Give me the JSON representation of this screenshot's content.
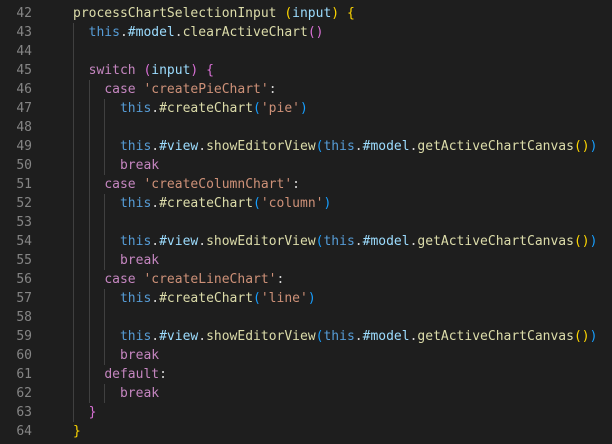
{
  "editor": {
    "lines": [
      {
        "num": "42",
        "tokens": [
          [
            "fn",
            "processChartSelectionInput"
          ],
          [
            "pl",
            " "
          ],
          [
            "b1",
            "("
          ],
          [
            "var",
            "input"
          ],
          [
            "b1",
            ")"
          ],
          [
            "pl",
            " "
          ],
          [
            "b1",
            "{"
          ]
        ]
      },
      {
        "num": "43",
        "tokens": [
          [
            "pl",
            "  "
          ],
          [
            "kw",
            "this"
          ],
          [
            "pl",
            "."
          ],
          [
            "var",
            "#model"
          ],
          [
            "pl",
            "."
          ],
          [
            "fn",
            "clearActiveChart"
          ],
          [
            "b2",
            "()"
          ]
        ]
      },
      {
        "num": "44",
        "tokens": []
      },
      {
        "num": "45",
        "tokens": [
          [
            "pl",
            "  "
          ],
          [
            "ctl",
            "switch"
          ],
          [
            "pl",
            " "
          ],
          [
            "b2",
            "("
          ],
          [
            "var",
            "input"
          ],
          [
            "b2",
            ")"
          ],
          [
            "pl",
            " "
          ],
          [
            "b2",
            "{"
          ]
        ]
      },
      {
        "num": "46",
        "tokens": [
          [
            "pl",
            "    "
          ],
          [
            "ctl",
            "case"
          ],
          [
            "pl",
            " "
          ],
          [
            "str",
            "'createPieChart'"
          ],
          [
            "pl",
            ":"
          ]
        ]
      },
      {
        "num": "47",
        "tokens": [
          [
            "pl",
            "      "
          ],
          [
            "kw",
            "this"
          ],
          [
            "pl",
            "."
          ],
          [
            "fn",
            "#createChart"
          ],
          [
            "b3",
            "("
          ],
          [
            "str",
            "'pie'"
          ],
          [
            "b3",
            ")"
          ]
        ]
      },
      {
        "num": "48",
        "tokens": []
      },
      {
        "num": "49",
        "tokens": [
          [
            "pl",
            "      "
          ],
          [
            "kw",
            "this"
          ],
          [
            "pl",
            "."
          ],
          [
            "var",
            "#view"
          ],
          [
            "pl",
            "."
          ],
          [
            "fn",
            "showEditorView"
          ],
          [
            "b3",
            "("
          ],
          [
            "kw",
            "this"
          ],
          [
            "pl",
            "."
          ],
          [
            "var",
            "#model"
          ],
          [
            "pl",
            "."
          ],
          [
            "fn",
            "getActiveChartCanvas"
          ],
          [
            "b1",
            "()"
          ],
          [
            "b3",
            ")"
          ]
        ]
      },
      {
        "num": "50",
        "tokens": [
          [
            "pl",
            "      "
          ],
          [
            "ctl",
            "break"
          ]
        ]
      },
      {
        "num": "51",
        "tokens": [
          [
            "pl",
            "    "
          ],
          [
            "ctl",
            "case"
          ],
          [
            "pl",
            " "
          ],
          [
            "str",
            "'createColumnChart'"
          ],
          [
            "pl",
            ":"
          ]
        ]
      },
      {
        "num": "52",
        "tokens": [
          [
            "pl",
            "      "
          ],
          [
            "kw",
            "this"
          ],
          [
            "pl",
            "."
          ],
          [
            "fn",
            "#createChart"
          ],
          [
            "b3",
            "("
          ],
          [
            "str",
            "'column'"
          ],
          [
            "b3",
            ")"
          ]
        ]
      },
      {
        "num": "53",
        "tokens": []
      },
      {
        "num": "54",
        "tokens": [
          [
            "pl",
            "      "
          ],
          [
            "kw",
            "this"
          ],
          [
            "pl",
            "."
          ],
          [
            "var",
            "#view"
          ],
          [
            "pl",
            "."
          ],
          [
            "fn",
            "showEditorView"
          ],
          [
            "b3",
            "("
          ],
          [
            "kw",
            "this"
          ],
          [
            "pl",
            "."
          ],
          [
            "var",
            "#model"
          ],
          [
            "pl",
            "."
          ],
          [
            "fn",
            "getActiveChartCanvas"
          ],
          [
            "b1",
            "()"
          ],
          [
            "b3",
            ")"
          ]
        ]
      },
      {
        "num": "55",
        "tokens": [
          [
            "pl",
            "      "
          ],
          [
            "ctl",
            "break"
          ]
        ]
      },
      {
        "num": "56",
        "tokens": [
          [
            "pl",
            "    "
          ],
          [
            "ctl",
            "case"
          ],
          [
            "pl",
            " "
          ],
          [
            "str",
            "'createLineChart'"
          ],
          [
            "pl",
            ":"
          ]
        ]
      },
      {
        "num": "57",
        "tokens": [
          [
            "pl",
            "      "
          ],
          [
            "kw",
            "this"
          ],
          [
            "pl",
            "."
          ],
          [
            "fn",
            "#createChart"
          ],
          [
            "b3",
            "("
          ],
          [
            "str",
            "'line'"
          ],
          [
            "b3",
            ")"
          ]
        ]
      },
      {
        "num": "58",
        "tokens": []
      },
      {
        "num": "59",
        "tokens": [
          [
            "pl",
            "      "
          ],
          [
            "kw",
            "this"
          ],
          [
            "pl",
            "."
          ],
          [
            "var",
            "#view"
          ],
          [
            "pl",
            "."
          ],
          [
            "fn",
            "showEditorView"
          ],
          [
            "b3",
            "("
          ],
          [
            "kw",
            "this"
          ],
          [
            "pl",
            "."
          ],
          [
            "var",
            "#model"
          ],
          [
            "pl",
            "."
          ],
          [
            "fn",
            "getActiveChartCanvas"
          ],
          [
            "b1",
            "()"
          ],
          [
            "b3",
            ")"
          ]
        ]
      },
      {
        "num": "60",
        "tokens": [
          [
            "pl",
            "      "
          ],
          [
            "ctl",
            "break"
          ]
        ]
      },
      {
        "num": "61",
        "tokens": [
          [
            "pl",
            "    "
          ],
          [
            "ctl",
            "default"
          ],
          [
            "pl",
            ":"
          ]
        ]
      },
      {
        "num": "62",
        "tokens": [
          [
            "pl",
            "      "
          ],
          [
            "ctl",
            "break"
          ]
        ]
      },
      {
        "num": "63",
        "tokens": [
          [
            "pl",
            "  "
          ],
          [
            "b2",
            "}"
          ]
        ]
      },
      {
        "num": "64",
        "tokens": [
          [
            "b1",
            "}"
          ]
        ]
      }
    ]
  },
  "colors": {
    "background": "#1e1e1e",
    "line_number": "#858585",
    "function": "#dcdcaa",
    "keyword": "#569cd6",
    "control": "#c586c0",
    "variable": "#9cdcfe",
    "string": "#ce9178",
    "bracket_1": "#ffd700",
    "bracket_2": "#da70d6",
    "bracket_3": "#179fff",
    "indent_guide": "#404040"
  }
}
